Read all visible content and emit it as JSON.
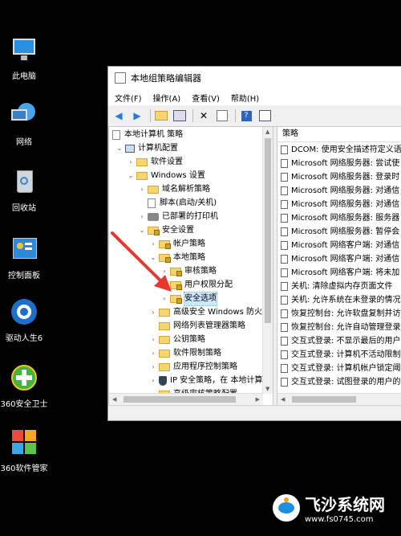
{
  "desktop": {
    "icons": [
      {
        "label": "此电脑"
      },
      {
        "label": "网络"
      },
      {
        "label": "回收站"
      },
      {
        "label": "控制面板"
      },
      {
        "label": "驱动人生6"
      },
      {
        "label": "360安全卫士"
      },
      {
        "label": "360软件管家"
      }
    ]
  },
  "window": {
    "title": "本地组策略编辑器",
    "menu": [
      "文件(F)",
      "操作(A)",
      "查看(V)",
      "帮助(H)"
    ]
  },
  "tree": {
    "items": [
      {
        "label": "本地计算机 策略"
      },
      {
        "label": "计算机配置"
      },
      {
        "label": "软件设置"
      },
      {
        "label": "Windows 设置"
      },
      {
        "label": "域名解析策略"
      },
      {
        "label": "脚本(启动/关机)"
      },
      {
        "label": "已部署的打印机"
      },
      {
        "label": "安全设置"
      },
      {
        "label": "帐户策略"
      },
      {
        "label": "本地策略"
      },
      {
        "label": "审核策略"
      },
      {
        "label": "用户权限分配"
      },
      {
        "label": "安全选项"
      },
      {
        "label": "高级安全 Windows 防火"
      },
      {
        "label": "网络列表管理器策略"
      },
      {
        "label": "公钥策略"
      },
      {
        "label": "软件限制策略"
      },
      {
        "label": "应用程序控制策略"
      },
      {
        "label": "IP 安全策略，在 本地计算"
      },
      {
        "label": "高级审核策略配置"
      }
    ]
  },
  "right_pane": {
    "column_header": "策略",
    "policies": [
      "DCOM: 使用安全描述符定义语",
      "Microsoft 网络服务器: 尝试使",
      "Microsoft 网络服务器: 登录时",
      "Microsoft 网络服务器: 对通信",
      "Microsoft 网络服务器: 对通信",
      "Microsoft 网络服务器: 服务器",
      "Microsoft 网络服务器: 暂停会",
      "Microsoft 网络客户端: 对通信",
      "Microsoft 网络客户端: 对通信",
      "Microsoft 网络客户端: 将未加",
      "关机: 清除虚拟内存页面文件",
      "关机: 允许系统在未登录的情况",
      "恢复控制台: 允许软盘复制并访",
      "恢复控制台: 允许自动管理登录",
      "交互式登录: 不显示最后的用户",
      "交互式登录: 计算机不活动限制",
      "交互式登录: 计算机帐户锁定阈",
      "交互式登录: 试图登录的用户的"
    ]
  },
  "watermark": {
    "title": "飞沙系统网",
    "url": "www.fs0745.com"
  },
  "colors": {
    "desktop": "#000000",
    "arrow": "#e8372c",
    "selection": "#cce8ff",
    "folder": "#f6d46e"
  }
}
